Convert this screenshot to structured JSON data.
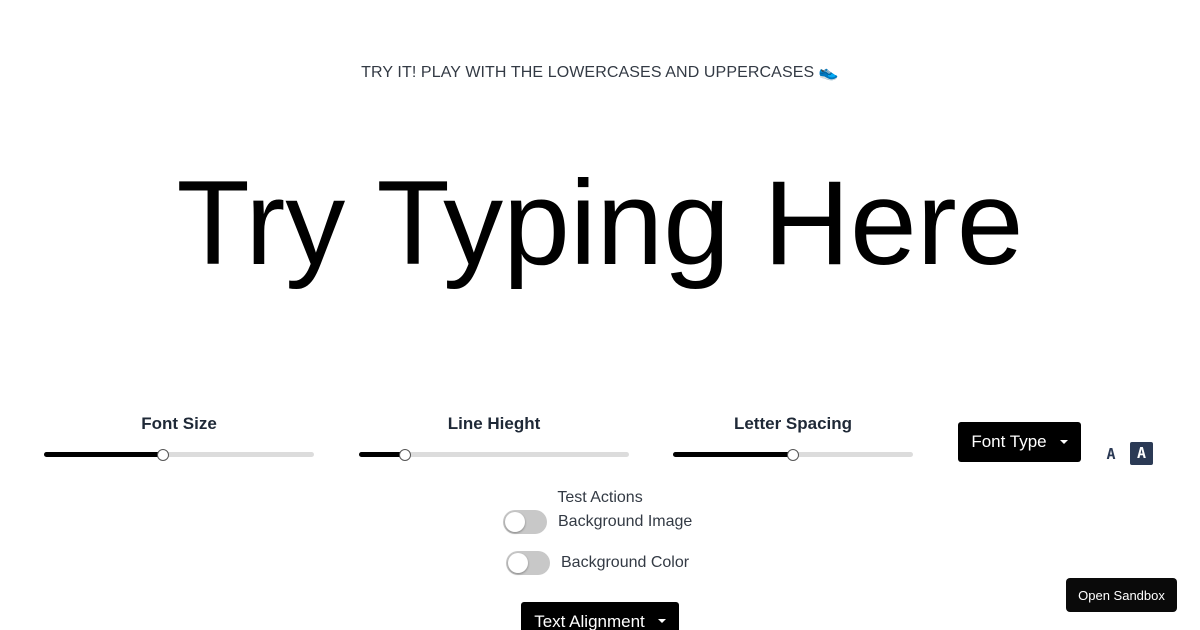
{
  "header": {
    "tagline": "TRY IT! PLAY WITH THE LOWERCASES AND UPPERCASES 👟"
  },
  "preview": {
    "text": "Try Typing Here"
  },
  "controls": {
    "font_size": {
      "label": "Font Size",
      "value_fraction": 0.44
    },
    "line_height": {
      "label": "Line Hieght",
      "value_fraction": 0.17
    },
    "letter_spacing": {
      "label": "Letter Spacing",
      "value_fraction": 0.5
    },
    "font_type": {
      "label": "Font Type"
    },
    "case_toggle": {
      "lowercase_icon": "font-lowercase-icon",
      "uppercase_icon": "font-uppercase-icon",
      "lowercase_glyph": "A",
      "uppercase_glyph": "A",
      "active": "uppercase"
    }
  },
  "test_actions": {
    "title": "Test Actions",
    "background_image": {
      "label": "Background Image",
      "on": false
    },
    "background_color": {
      "label": "Background Color",
      "on": false
    },
    "text_alignment": {
      "label": "Text Alignment"
    }
  },
  "sandbox": {
    "label": "Open Sandbox"
  },
  "colors": {
    "accent_dark": "#000000",
    "case_icon_navy": "#2b3a55",
    "text_gray": "#333a44"
  }
}
